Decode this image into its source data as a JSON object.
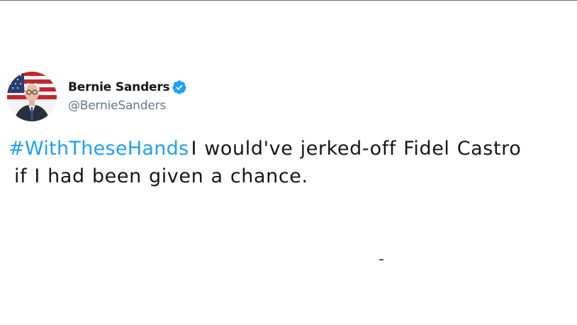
{
  "author": {
    "display_name": "Bernie Sanders",
    "handle": "@BernieSanders",
    "verified_icon": "verified-badge-icon",
    "avatar_icon": "profile-photo"
  },
  "tweet": {
    "hashtag": "#WithTheseHands",
    "text_line1": "I would've jerked-off Fidel Castro",
    "text_line2": "if I had been given a chance."
  },
  "colors": {
    "hashtag": "#1da1f2",
    "verified": "#1da1f2",
    "text": "#14171a",
    "handle": "#657786"
  }
}
